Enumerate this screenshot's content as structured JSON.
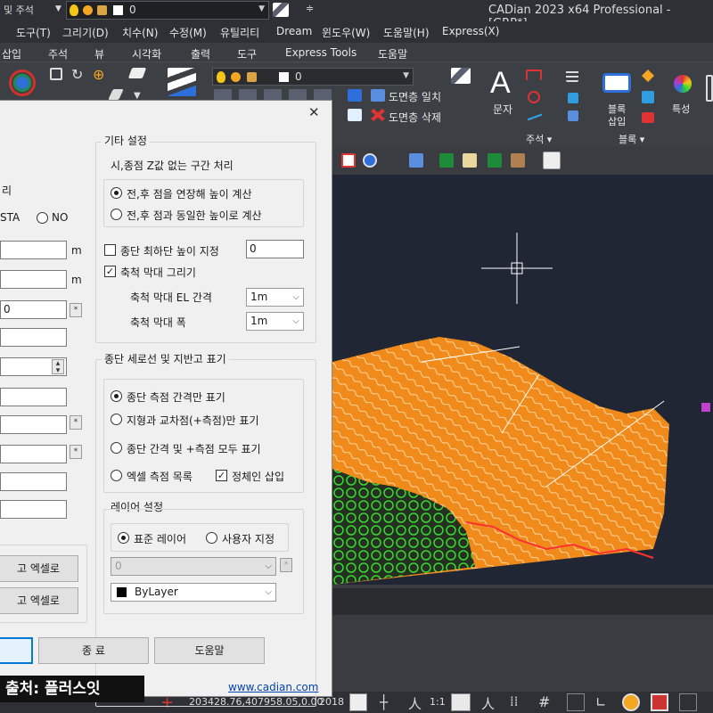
{
  "titlebar": {
    "workspace": "및 주석",
    "layer_value": "0",
    "window_title": "CADian 2023 x64 Professional - [GRP*]"
  },
  "menu": [
    "도구(T)",
    "그리기(D)",
    "치수(N)",
    "수정(M)",
    "유틸리티",
    "Dream",
    "윈도우(W)",
    "도움말(H)",
    "Express(X)"
  ],
  "ribbon_tabs": [
    "삽입",
    "주석",
    "뷰",
    "시각화",
    "출력",
    "도구",
    "Express Tools",
    "도움말"
  ],
  "ribbon": {
    "layer_combo_value": "0",
    "layer_match": "도면층 일치",
    "layer_delete": "도면층 삭제",
    "text_label": "문자",
    "annotation_panel": "주석 ▾",
    "block_insert_1": "블록",
    "block_insert_2": "삽입",
    "block_panel": "블록 ▾",
    "properties_label": "특성"
  },
  "dialog": {
    "close": "✕",
    "left": {
      "partial_label": "리",
      "sta_label": "STA",
      "no_label": "NO",
      "unit_1": "m",
      "unit_2": "m",
      "field_3_value": "0",
      "star": "*",
      "btn_excel_1": "고 엑셀로",
      "btn_excel_2": "고 엑셀로"
    },
    "other_settings": {
      "title": "기타 설정",
      "subtitle": "시,종점 Z값 없는 구간 처리",
      "opt_extend": "전,후 점을 연장해 높이 계산",
      "opt_same": "전,후 점과 동일한 높이로 계산",
      "min_height_label": "종단 최하단 높이 지정",
      "min_height_value": "0",
      "draw_scale_bar": "축척 막대 그리기",
      "el_interval_label": "축척  막대 EL 간격",
      "el_interval_value": "1m",
      "width_label": "축척 막대 폭",
      "width_value": "1m"
    },
    "profile_section": {
      "title": "종단 세로선 및 지반고 표기",
      "opt1": "종단 측점 간격만 표기",
      "opt2": "지형과 교차점(+측점)만 표기",
      "opt3": "종단 간격 및 +측점 모두 표기",
      "opt4": "엑셀 측점 목록",
      "chain_insert": "정체인 삽입"
    },
    "layer_section": {
      "title": "레이어 설정",
      "standard": "표준 레이어",
      "user": "사용자 지정",
      "layer_value": "0",
      "color_value": "ByLayer"
    },
    "buttons": {
      "end": "종 료",
      "help": "도움말"
    },
    "website": "www.cadian.com"
  },
  "status": {
    "coords": "203428.76,407958.05,0.00",
    "year": "2018",
    "scale": "1:1"
  },
  "watermark": "출처: 플러스잇",
  "colors": {
    "terrain_orange": "#f08a1a",
    "contour_green": "#2fdc2f",
    "canvas_bg": "#202633",
    "dialog_bg": "#f0f0f0"
  }
}
